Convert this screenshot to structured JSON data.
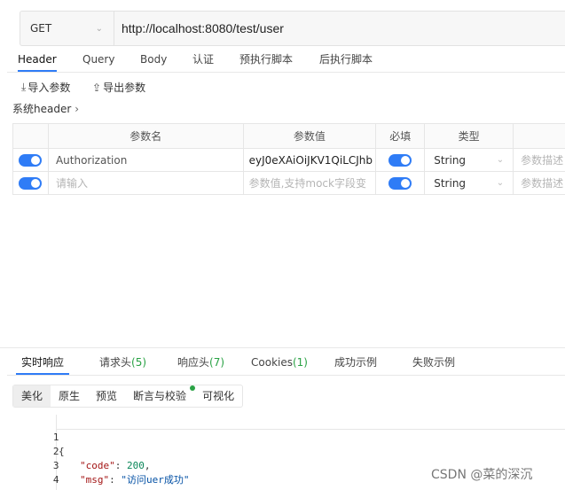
{
  "request": {
    "method": "GET",
    "url": "http://localhost:8080/test/user"
  },
  "tabs": [
    "Header",
    "Query",
    "Body",
    "认证",
    "预执行脚本",
    "后执行脚本"
  ],
  "actions": {
    "import": "导入参数",
    "export": "导出参数"
  },
  "system_header": "系统header",
  "params_table": {
    "headers": [
      "参数名",
      "参数值",
      "必填",
      "类型",
      ""
    ],
    "rows": [
      {
        "name": "Authorization",
        "value": "eyJ0eXAiOiJKV1QiLCJhb",
        "type": "String",
        "desc": "参数描述"
      },
      {
        "name_placeholder": "请输入",
        "value_placeholder": "参数值,支持mock字段变",
        "type": "String",
        "desc": "参数描述"
      }
    ]
  },
  "response_tabs": [
    {
      "label": "实时响应",
      "count": ""
    },
    {
      "label": "请求头",
      "count": "(5)"
    },
    {
      "label": "响应头",
      "count": "(7)"
    },
    {
      "label": "Cookies",
      "count": "(1)"
    },
    {
      "label": "成功示例",
      "count": ""
    },
    {
      "label": "失败示例",
      "count": ""
    }
  ],
  "view_modes": [
    "美化",
    "原生",
    "预览",
    "断言与校验",
    "可视化"
  ],
  "code": {
    "line_numbers": [
      "1",
      "2",
      "3",
      "4"
    ],
    "open": "{",
    "code_key": "\"code\"",
    "code_val": "200",
    "msg_key": "\"msg\"",
    "msg_val": "\"访问uer成功\"",
    "close": "}"
  },
  "watermark": "CSDN @菜的深沉",
  "colors": {
    "accent": "#2f7cf6",
    "count_green": "#2aa245"
  }
}
